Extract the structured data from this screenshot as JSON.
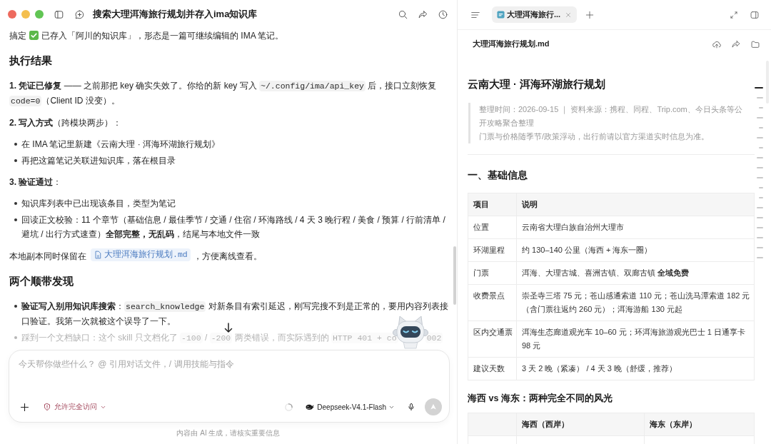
{
  "window": {
    "title": "搜索大理洱海旅行规划并存入ima知识库"
  },
  "conversation": {
    "blocks": [
      {
        "kind": "para",
        "parts": [
          {
            "kind": "text",
            "text": "搞定"
          },
          {
            "kind": "check"
          },
          {
            "kind": "text",
            "text": "已存入「阿川的知识库」，形态是一篇可继续编辑的 IMA 笔记。"
          }
        ]
      },
      {
        "kind": "heading",
        "text": "执行结果"
      },
      {
        "kind": "para",
        "parts": [
          {
            "kind": "text",
            "text": "**1. 凭证已修复** —— 之前那把 key 确实失效了。你给的新 key 写入 "
          },
          {
            "kind": "code",
            "text": "~/.config/ima/api_key"
          },
          {
            "kind": "text",
            "text": " 后，接口立刻恢复 "
          },
          {
            "kind": "code",
            "text": "code=0"
          },
          {
            "kind": "text",
            "text": "（Client ID 没变）。"
          }
        ]
      },
      {
        "kind": "para",
        "parts": [
          {
            "kind": "text",
            "text": "**2. 写入方式**（跨模块两步）："
          }
        ]
      },
      {
        "kind": "bullets",
        "items": [
          {
            "parts": [
              {
                "kind": "text",
                "text": "在 IMA 笔记里新建《云南大理 · 洱海环湖旅行规划》"
              }
            ]
          },
          {
            "parts": [
              {
                "kind": "text",
                "text": "再把这篇笔记关联进知识库，落在根目录"
              }
            ]
          }
        ]
      },
      {
        "kind": "para",
        "parts": [
          {
            "kind": "text",
            "text": "**3. 验证通过**："
          }
        ]
      },
      {
        "kind": "bullets",
        "items": [
          {
            "parts": [
              {
                "kind": "text",
                "text": "知识库列表中已出现该条目，类型为笔记"
              }
            ]
          },
          {
            "parts": [
              {
                "kind": "text",
                "text": "回读正文校验：11 个章节（基础信息 / 最佳季节 / 交通 / 住宿 / 环海路线 / 4 天 3 晚行程 / 美食 / 预算 / 行前清单 / 避坑 / 出行方式速查）**全部完整，无乱码**，结尾与本地文件一致"
              }
            ]
          }
        ]
      },
      {
        "kind": "para",
        "parts": [
          {
            "kind": "text",
            "text": "本地副本同时保留在"
          },
          {
            "kind": "file_link",
            "text": "大理洱海旅行规划.md"
          },
          {
            "kind": "text",
            "text": "，方便离线查看。"
          }
        ]
      },
      {
        "kind": "heading",
        "text": "两个顺带发现"
      },
      {
        "kind": "bullets",
        "items": [
          {
            "parts": [
              {
                "kind": "text",
                "text": "**验证写入别用知识库搜索**："
              },
              {
                "kind": "code",
                "text": "search_knowledge"
              },
              {
                "kind": "text",
                "text": " 对新条目有索引延迟，刚写完搜不到是正常的，要用内容列表接口验证。我第一次就被这个误导了一下。"
              }
            ]
          },
          {
            "parts": [
              {
                "kind": "text",
                "text": "踩到一个文档缺口：这个 skill 只文档化了 "
              },
              {
                "kind": "code",
                "text": "-100"
              },
              {
                "kind": "text",
                "text": " / "
              },
              {
                "kind": "code",
                "text": "-200"
              },
              {
                "kind": "text",
                "text": " 两类错误，而实际遇到的 "
              },
              {
                "kind": "code",
                "text": "HTTP 401 + co"
              },
              {
                "kind": "code",
                "text": "002"
              }
            ]
          }
        ]
      }
    ]
  },
  "composer": {
    "placeholder": "今天帮你做些什么？ @ 引用对话文件，/ 调用技能与指令",
    "access_mode": "允许完全访问",
    "busy": true,
    "model": "Deepseek-V4.1-Flash",
    "send_button": {
      "disabled": true
    }
  },
  "disclaimer": "内容由 AI 生成，请核实重要信息",
  "preview": {
    "tabs": [
      {
        "label": "大理洱海旅行...",
        "selected": true
      }
    ],
    "file_name": "大理洱海旅行规划.md",
    "document": [
      {
        "kind": "title",
        "text": "云南大理 · 洱海环湖旅行规划"
      },
      {
        "kind": "quote",
        "lines": [
          "整理时间：2026-09-15 ｜ 资料来源：携程、同程、Trip.com、今日头条等公开攻略聚合整理",
          "门票与价格随季节/政策浮动，出行前请以官方渠道实时信息为准。"
        ]
      },
      {
        "kind": "rule"
      },
      {
        "kind": "heading",
        "text": "一、基础信息"
      },
      {
        "kind": "table",
        "columns": [
          "项目",
          "说明"
        ],
        "rows": [
          [
            "位置",
            "云南省大理白族自治州大理市"
          ],
          [
            "环湖里程",
            "约 130–140 公里（海西 + 海东一圈）"
          ],
          [
            "门票",
            "洱海、大理古城、喜洲古镇、双廊古镇 **全域免费**"
          ],
          [
            "收费景点",
            "崇圣寺三塔 75 元；苍山感通索道 110 元；苍山洗马潭索道 182 元（含门票往返约 260 元）；洱海游船 130 元起"
          ],
          [
            "区内交通票",
            "洱海生态廊道观光车 10–60 元；环洱海旅游观光巴士 1 日通享卡 98 元"
          ],
          [
            "建议天数",
            "3 天 2 晚（紧凑） / 4 天 3 晚（舒缓，推荐）"
          ]
        ]
      },
      {
        "kind": "subheading",
        "text": "海西 vs 海东：两种完全不同的风光"
      },
      {
        "kind": "table",
        "has_row_labels": true,
        "columns": [
          "海西（西岸）",
          "海东（东岸）"
        ]
      }
    ],
    "outline": [
      {
        "kind": "h1",
        "selected": true
      },
      {
        "kind": "h2",
        "selected": false
      },
      {
        "kind": "h3",
        "selected": false
      },
      {
        "kind": "h2",
        "selected": false
      },
      {
        "kind": "h3",
        "selected": false
      },
      {
        "kind": "h2",
        "selected": false
      },
      {
        "kind": "h3",
        "selected": false
      },
      {
        "kind": "h2",
        "selected": false
      },
      {
        "kind": "h2",
        "selected": false
      },
      {
        "kind": "h2",
        "selected": false
      },
      {
        "kind": "h3",
        "selected": false
      },
      {
        "kind": "h3",
        "selected": false
      },
      {
        "kind": "h2",
        "selected": false
      },
      {
        "kind": "h2",
        "selected": false
      },
      {
        "kind": "h2",
        "selected": false
      },
      {
        "kind": "h2",
        "selected": false
      },
      {
        "kind": "h2",
        "selected": false
      },
      {
        "kind": "h2",
        "selected": false
      }
    ]
  }
}
